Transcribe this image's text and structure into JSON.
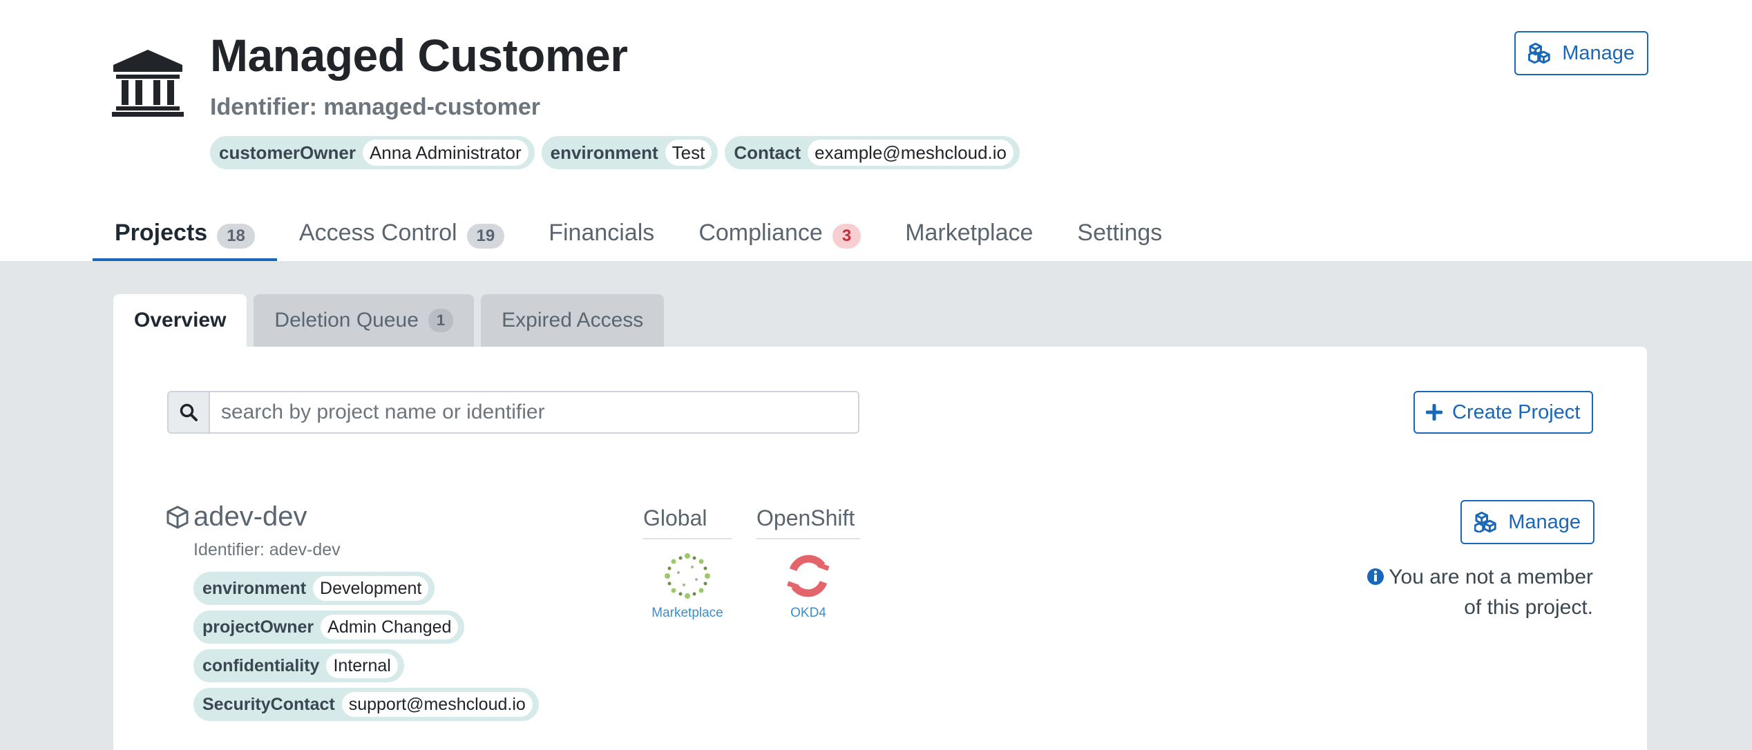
{
  "header": {
    "title": "Managed Customer",
    "identifier": "Identifier: managed-customer",
    "tags": [
      {
        "key": "customerOwner",
        "value": "Anna Administrator"
      },
      {
        "key": "environment",
        "value": "Test"
      },
      {
        "key": "Contact",
        "value": "example@meshcloud.io"
      }
    ],
    "manage_label": "Manage"
  },
  "main_tabs": [
    {
      "label": "Projects",
      "badge": "18"
    },
    {
      "label": "Access Control",
      "badge": "19"
    },
    {
      "label": "Financials"
    },
    {
      "label": "Compliance",
      "badge": "3"
    },
    {
      "label": "Marketplace"
    },
    {
      "label": "Settings"
    }
  ],
  "sub_tabs": [
    {
      "label": "Overview"
    },
    {
      "label": "Deletion Queue",
      "badge": "1"
    },
    {
      "label": "Expired Access"
    }
  ],
  "search": {
    "placeholder": "search by project name or identifier"
  },
  "create_project_label": "Create Project",
  "project": {
    "name": "adev-dev",
    "identifier": "Identifier: adev-dev",
    "tags": [
      {
        "key": "environment",
        "value": "Development"
      },
      {
        "key": "projectOwner",
        "value": "Admin Changed"
      },
      {
        "key": "confidentiality",
        "value": "Internal"
      },
      {
        "key": "SecurityContact",
        "value": "support@meshcloud.io"
      }
    ],
    "platforms": [
      {
        "heading": "Global",
        "label": "Marketplace",
        "icon": "marketplace-icon"
      },
      {
        "heading": "OpenShift",
        "label": "OKD4",
        "icon": "okd-icon"
      }
    ],
    "manage_label": "Manage",
    "not_member_line1": "You are not a member",
    "not_member_line2": "of this project."
  },
  "colors": {
    "accent": "#1967b8",
    "tag_bg": "#d6ebe9",
    "danger": "#c0303a"
  }
}
